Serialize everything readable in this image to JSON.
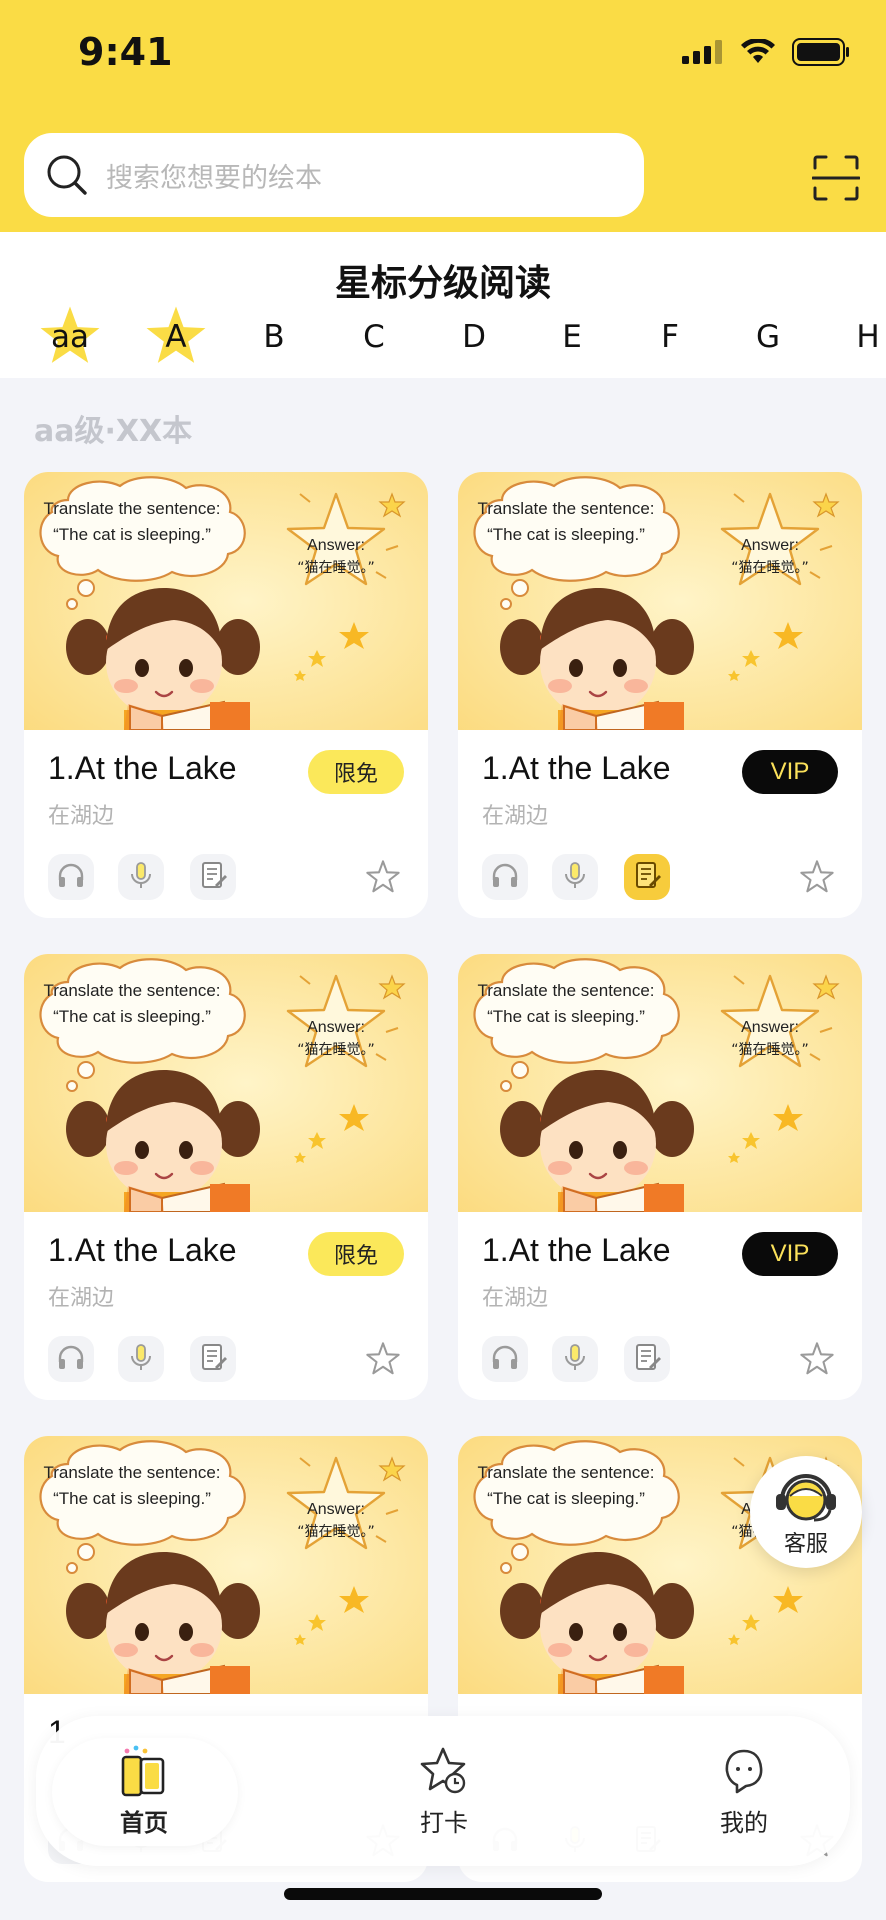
{
  "status_bar": {
    "time": "9:41"
  },
  "search": {
    "placeholder": "搜索您想要的绘本"
  },
  "level_section": {
    "title": "星标分级阅读",
    "tabs": [
      "aa",
      "A",
      "B",
      "C",
      "D",
      "E",
      "F",
      "G",
      "H"
    ],
    "starred_tabs": [
      "aa",
      "A"
    ]
  },
  "section_label": "aa级·XX本",
  "cover": {
    "prompt_line1": "Translate the sentence:",
    "prompt_line2": "“The cat is sleeping.”",
    "answer_label": "Answer:",
    "answer_text": "“猫在睡觉。”"
  },
  "books": [
    {
      "title": "1.At the Lake",
      "subtitle": "在湖边",
      "badge": "限免",
      "badge_type": "free",
      "active_tool": "none"
    },
    {
      "title": "1.At the Lake",
      "subtitle": "在湖边",
      "badge": "VIP",
      "badge_type": "vip",
      "active_tool": "worksheet"
    },
    {
      "title": "1.At the Lake",
      "subtitle": "在湖边",
      "badge": "限免",
      "badge_type": "free",
      "active_tool": "none"
    },
    {
      "title": "1.At the Lake",
      "subtitle": "在湖边",
      "badge": "VIP",
      "badge_type": "vip",
      "active_tool": "none"
    },
    {
      "title": "1",
      "subtitle": "",
      "badge": "",
      "badge_type": "free",
      "active_tool": "none"
    },
    {
      "title": "",
      "subtitle": "",
      "badge": "",
      "badge_type": "vip",
      "active_tool": "none"
    }
  ],
  "tool_icons": [
    "headphones-icon",
    "microphone-icon",
    "worksheet-icon"
  ],
  "service": {
    "label": "客服"
  },
  "tabbar": {
    "items": [
      {
        "label": "首页",
        "icon": "book-icon",
        "active": true
      },
      {
        "label": "打卡",
        "icon": "star-clock-icon",
        "active": false
      },
      {
        "label": "我的",
        "icon": "profile-icon",
        "active": false
      }
    ]
  },
  "colors": {
    "accent_yellow": "#fadc45",
    "vip_black": "#0a0a0a",
    "free_badge": "#fbe85a",
    "active_tool": "#f7cc3c"
  }
}
